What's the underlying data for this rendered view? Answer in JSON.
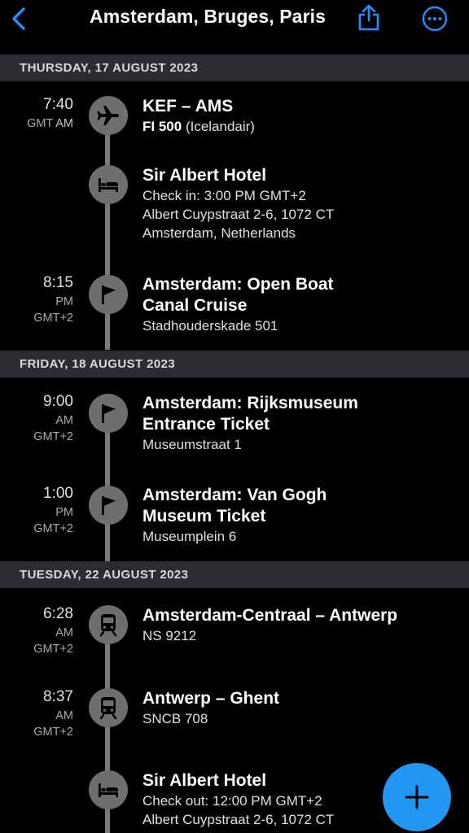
{
  "header": {
    "title": "Amsterdam, Bruges, Paris",
    "back_icon": "chevron-left-icon",
    "share_icon": "share-icon",
    "more_icon": "ellipsis-circle-icon",
    "accent": "#1e90ff"
  },
  "days": [
    {
      "label": "THURSDAY, 17 AUGUST 2023",
      "items": [
        {
          "icon": "airplane-icon",
          "time": "7:40",
          "tz": "GMT",
          "ampm": "AM",
          "title": "KEF – AMS",
          "code": "FI 500",
          "carrier": "(Icelandair)"
        },
        {
          "icon": "bed-icon",
          "title": "Sir Albert Hotel",
          "line1": "Check in: 3:00 PM GMT+2",
          "line2": "Albert Cuypstraat 2-6, 1072 CT",
          "line3": "Amsterdam, Netherlands"
        },
        {
          "icon": "flag-icon",
          "time": "8:15",
          "ampm": "PM",
          "tz": "GMT+2",
          "title1": "Amsterdam: Open Boat",
          "title2": "Canal Cruise",
          "line1": "Stadhouderskade 501"
        }
      ]
    },
    {
      "label": "FRIDAY, 18 AUGUST 2023",
      "items": [
        {
          "icon": "flag-icon",
          "time": "9:00",
          "ampm": "AM",
          "tz": "GMT+2",
          "title1": "Amsterdam: Rijksmuseum",
          "title2": "Entrance Ticket",
          "line1": "Museumstraat 1"
        },
        {
          "icon": "flag-icon",
          "time": "1:00",
          "ampm": "PM",
          "tz": "GMT+2",
          "title1": "Amsterdam: Van Gogh",
          "title2": "Museum Ticket",
          "line1": "Museumplein 6"
        }
      ]
    },
    {
      "label": "TUESDAY, 22 AUGUST 2023",
      "items": [
        {
          "icon": "train-icon",
          "time": "6:28",
          "ampm": "AM",
          "tz": "GMT+2",
          "title": "Amsterdam-Centraal – Antwerp",
          "line1": "NS 9212"
        },
        {
          "icon": "train-icon",
          "time": "8:37",
          "ampm": "AM",
          "tz": "GMT+2",
          "title": "Antwerp – Ghent",
          "line1": "SNCB 708"
        },
        {
          "icon": "bed-icon",
          "title": "Sir Albert Hotel",
          "line1": "Check out: 12:00 PM GMT+2",
          "line2": "Albert Cuypstraat 2-6, 1072 CT"
        }
      ]
    }
  ],
  "fab": {
    "icon": "plus-icon",
    "color": "#2196f3"
  }
}
